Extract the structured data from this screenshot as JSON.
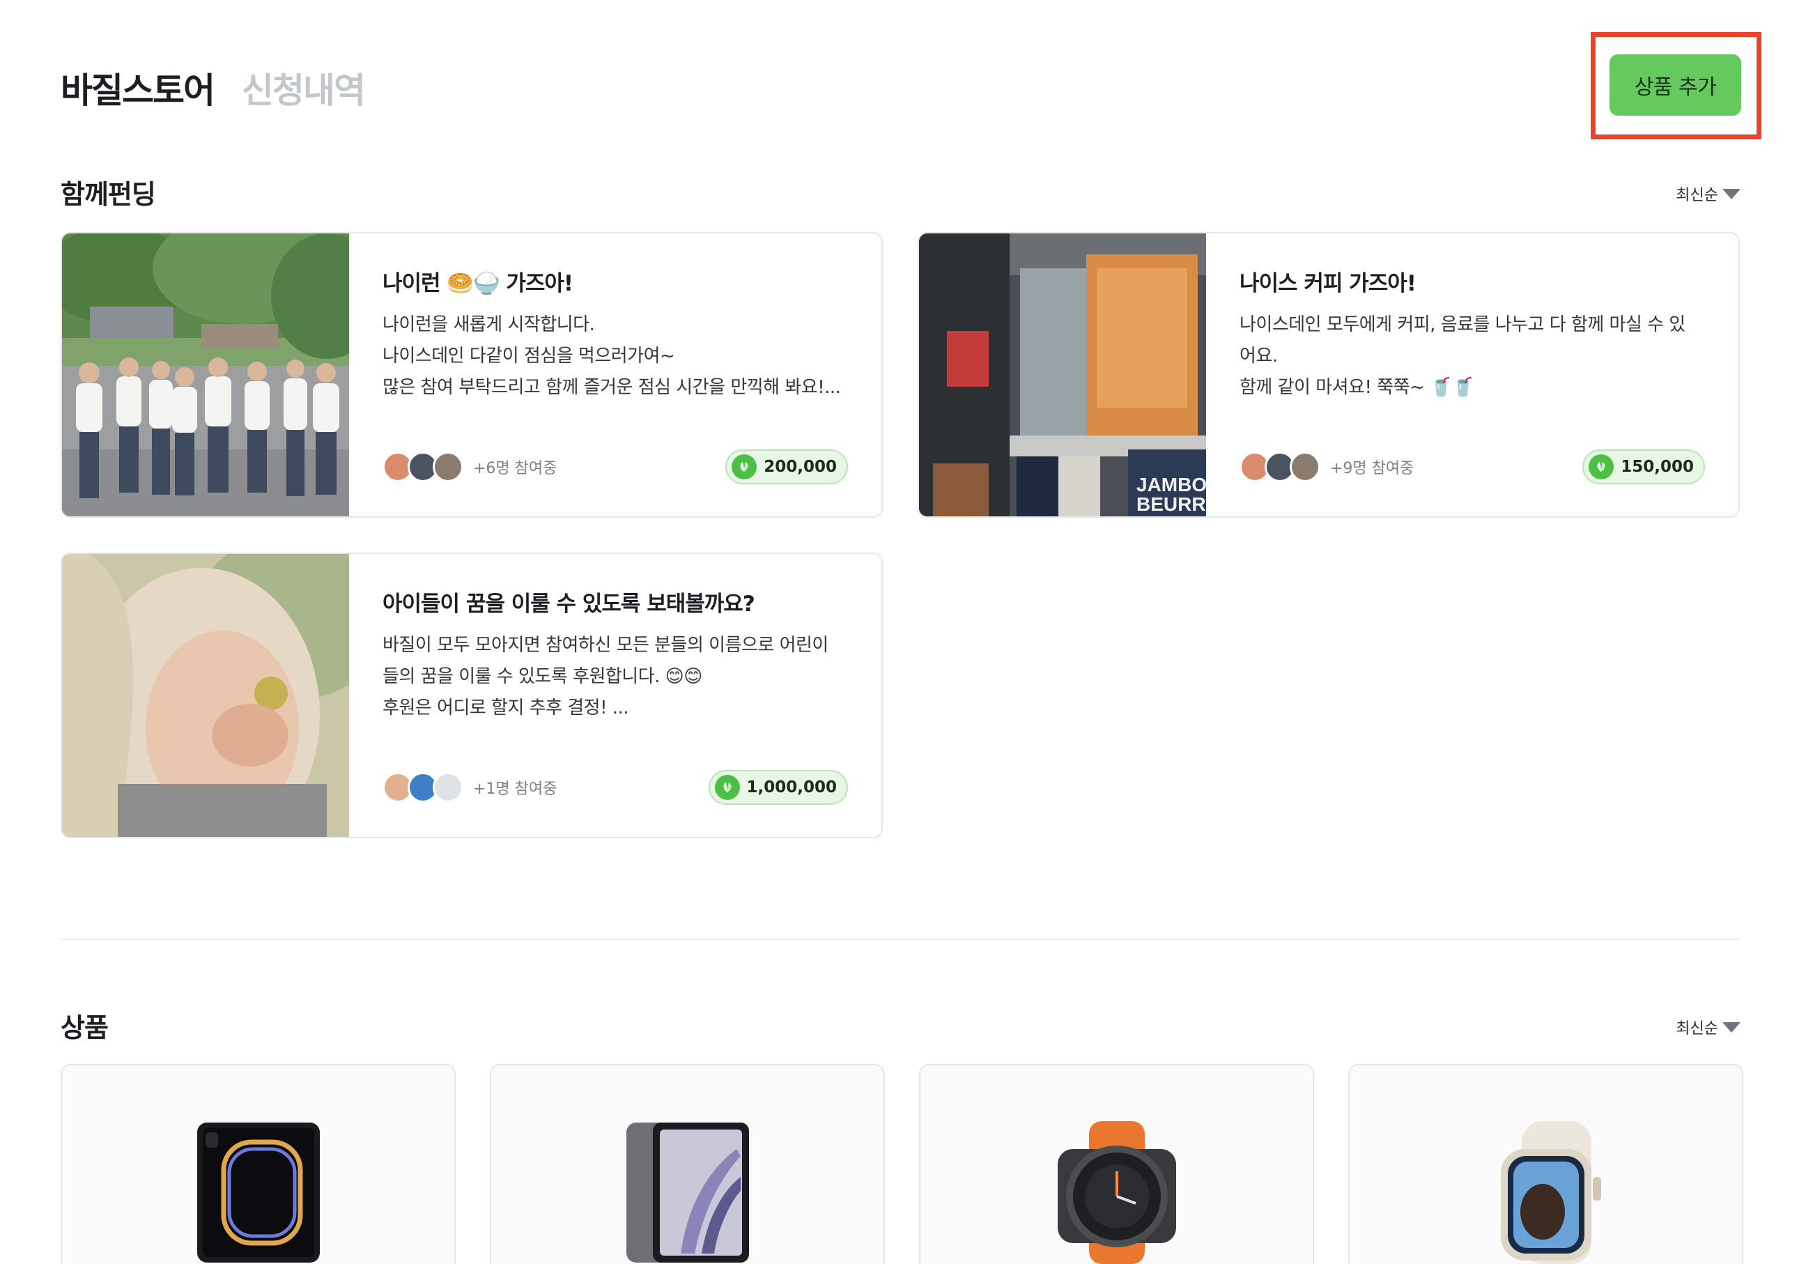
{
  "header": {
    "tab_store": "바질스토어",
    "tab_history": "신청내역",
    "add_button": "상품 추가"
  },
  "funding": {
    "title": "함께펀딩",
    "sort_label": "최신순",
    "cards": [
      {
        "title": "나이런 🥯🍚 가즈아!",
        "desc_lines": [
          "나이런을 새롭게 시작합니다.",
          "나이스데인 다같이 점심을 먹으러가여~",
          "많은 참여 부탁드리고 함께 즐거운 점심 시간을 만끽해 봐요!..."
        ],
        "participants": "+6명 참여중",
        "amount": "200,000"
      },
      {
        "title": "나이스 커피 가즈아!",
        "desc_lines": [
          "나이스데인 모두에게 커피, 음료를 나누고 다 함께 마실 수 있",
          "어요.",
          "함께 같이 마셔요! 쭉쭉~ 🥤🥤"
        ],
        "participants": "+9명 참여중",
        "amount": "150,000"
      },
      {
        "title": "아이들이 꿈을 이룰 수 있도록 보태볼까요?",
        "desc_lines": [
          "바질이 모두 모아지면 참여하신 모든 분들의 이름으로 어린이",
          "들의 꿈을 이룰 수 있도록 후원합니다. 😊😊",
          "후원은 어디로 할지 추후 결정! ..."
        ],
        "participants": "+1명 참여중",
        "amount": "1,000,000"
      }
    ]
  },
  "products": {
    "title": "상품",
    "sort_label": "최신순",
    "items": [
      {
        "icon": "ipad-pro-icon"
      },
      {
        "icon": "ipad-air-icon"
      },
      {
        "icon": "galaxy-watch-ultra-icon"
      },
      {
        "icon": "apple-watch-icon"
      }
    ]
  },
  "colors": {
    "accent_green": "#66c95d",
    "highlight_red": "#e8432b",
    "inactive_tab": "#c3c7cc"
  }
}
